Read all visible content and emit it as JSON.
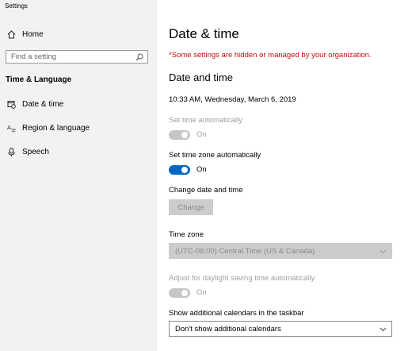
{
  "app": {
    "title": "Settings"
  },
  "sidebar": {
    "home_label": "Home",
    "search_placeholder": "Find a setting",
    "section": "Time & Language",
    "items": [
      {
        "label": "Date & time",
        "icon": "calendar-clock-icon"
      },
      {
        "label": "Region & language",
        "icon": "region-language-icon"
      },
      {
        "label": "Speech",
        "icon": "microphone-icon"
      }
    ]
  },
  "main": {
    "title": "Date & time",
    "warning": "*Some settings are hidden or managed by your organization.",
    "subtitle": "Date and time",
    "current_datetime": "10:33 AM, Wednesday, March 6, 2019",
    "set_time_auto": {
      "label": "Set time automatically",
      "state": "On",
      "enabled": false,
      "on": true
    },
    "set_tz_auto": {
      "label": "Set time zone automatically",
      "state": "On",
      "enabled": true,
      "on": true
    },
    "change_date": {
      "label": "Change date and time",
      "button": "Change"
    },
    "time_zone": {
      "label": "Time zone",
      "value": "(UTC-06:00) Central Time (US & Canada)"
    },
    "dst": {
      "label": "Adjust for daylight saving time automatically",
      "state": "On",
      "enabled": false,
      "on": true
    },
    "calendars": {
      "label": "Show additional calendars in the taskbar",
      "value": "Don't show additional calendars"
    }
  },
  "colors": {
    "accent": "#0067c0",
    "warning": "#c50f0f",
    "sidebar_bg": "#f2f2f2",
    "disabled": "#a0a0a0"
  }
}
